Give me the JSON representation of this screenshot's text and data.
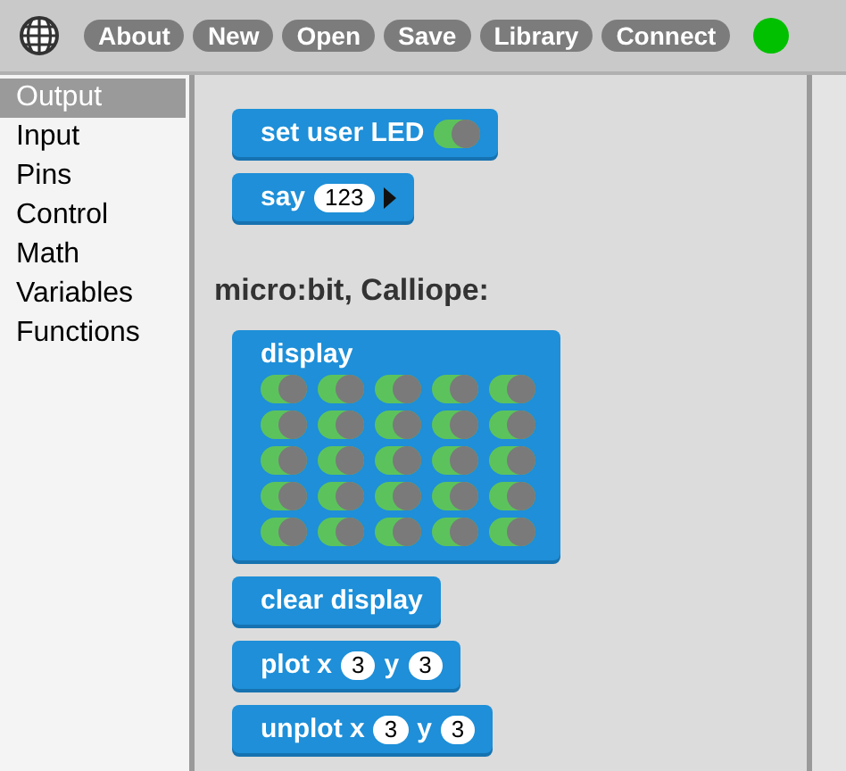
{
  "toolbar": {
    "buttons": [
      "About",
      "New",
      "Open",
      "Save",
      "Library",
      "Connect"
    ],
    "connected": true
  },
  "categories": [
    {
      "label": "Output",
      "selected": true
    },
    {
      "label": "Input",
      "selected": false
    },
    {
      "label": "Pins",
      "selected": false
    },
    {
      "label": "Control",
      "selected": false
    },
    {
      "label": "Math",
      "selected": false
    },
    {
      "label": "Variables",
      "selected": false
    },
    {
      "label": "Functions",
      "selected": false
    }
  ],
  "palette": [
    {
      "kind": "block",
      "parts": [
        {
          "kind": "text",
          "text": "set user LED"
        },
        {
          "kind": "toggle",
          "on": true
        }
      ]
    },
    {
      "kind": "block",
      "parts": [
        {
          "kind": "text",
          "text": "say"
        },
        {
          "kind": "number",
          "text": "123"
        },
        {
          "kind": "arrow"
        }
      ]
    },
    {
      "kind": "heading",
      "text": "micro:bit, Calliope:"
    },
    {
      "kind": "display",
      "label": "display",
      "rows": [
        [
          {
            "on": true
          },
          {
            "on": true
          },
          {
            "on": true
          },
          {
            "on": true
          },
          {
            "on": true
          }
        ],
        [
          {
            "on": true
          },
          {
            "on": true
          },
          {
            "on": true
          },
          {
            "on": true
          },
          {
            "on": true
          }
        ],
        [
          {
            "on": true
          },
          {
            "on": true
          },
          {
            "on": true
          },
          {
            "on": true
          },
          {
            "on": true
          }
        ],
        [
          {
            "on": true
          },
          {
            "on": true
          },
          {
            "on": true
          },
          {
            "on": true
          },
          {
            "on": true
          }
        ],
        [
          {
            "on": true
          },
          {
            "on": true
          },
          {
            "on": true
          },
          {
            "on": true
          },
          {
            "on": true
          }
        ]
      ]
    },
    {
      "kind": "block",
      "parts": [
        {
          "kind": "text",
          "text": "clear display"
        }
      ]
    },
    {
      "kind": "block",
      "parts": [
        {
          "kind": "text",
          "text": "plot x"
        },
        {
          "kind": "number",
          "text": "3"
        },
        {
          "kind": "text",
          "text": "y"
        },
        {
          "kind": "number",
          "text": "3"
        }
      ]
    },
    {
      "kind": "block",
      "parts": [
        {
          "kind": "text",
          "text": "unplot x"
        },
        {
          "kind": "number",
          "text": "3"
        },
        {
          "kind": "text",
          "text": "y"
        },
        {
          "kind": "number",
          "text": "3"
        }
      ]
    }
  ]
}
